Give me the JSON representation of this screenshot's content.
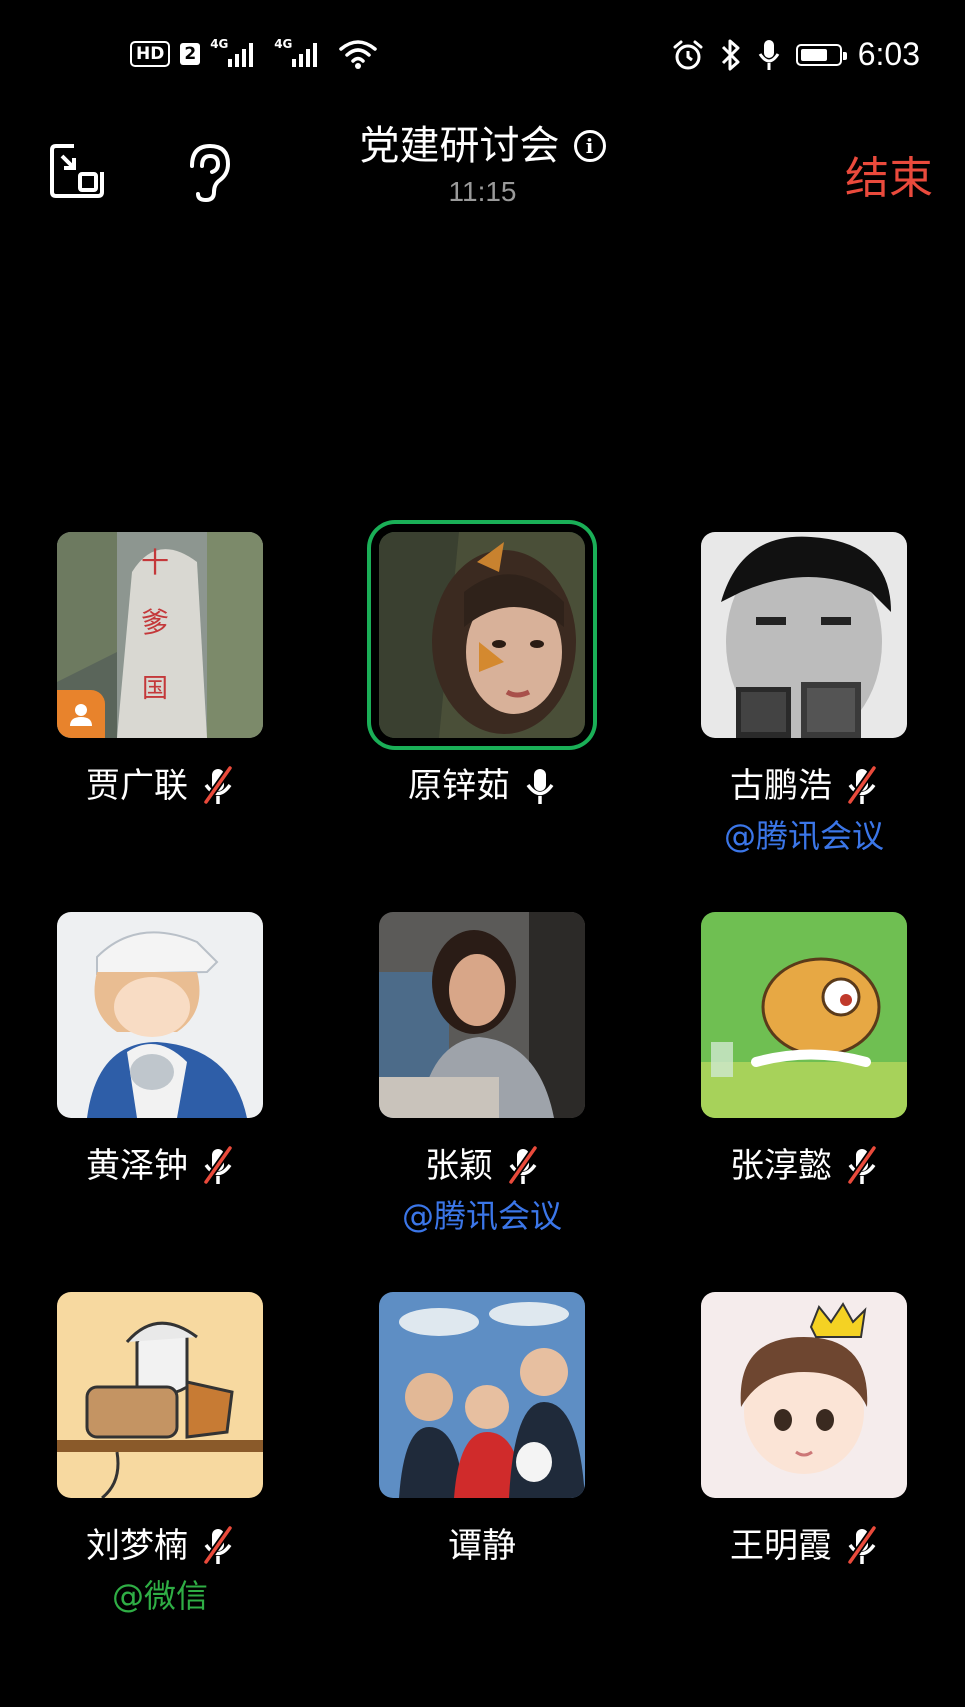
{
  "status_bar": {
    "hd_label": "HD",
    "sim_label": "2",
    "network_1": "4G",
    "network_2": "4G",
    "time": "6:03",
    "battery_level": 0.62,
    "icons": [
      "alarm-icon",
      "bluetooth-icon",
      "microphone-icon",
      "battery-icon",
      "wifi-icon"
    ]
  },
  "header": {
    "title": "党建研讨会",
    "duration": "11:15",
    "end_label": "结束",
    "end_color": "#ea4a3c",
    "icons": [
      "minimize-window-icon",
      "earpiece-icon",
      "info-icon"
    ]
  },
  "participants": [
    {
      "name": "贾广联",
      "mic": "muted",
      "tag": "",
      "host": true,
      "speaking": false
    },
    {
      "name": "原锌茹",
      "mic": "on",
      "tag": "",
      "host": false,
      "speaking": true
    },
    {
      "name": "古鹏浩",
      "mic": "muted",
      "tag": "@腾讯会议",
      "host": false,
      "speaking": false
    },
    {
      "name": "黄泽钟",
      "mic": "muted",
      "tag": "",
      "host": false,
      "speaking": false
    },
    {
      "name": "张颖",
      "mic": "muted",
      "tag": "@腾讯会议",
      "host": false,
      "speaking": false
    },
    {
      "name": "张淳懿",
      "mic": "muted",
      "tag": "",
      "host": false,
      "speaking": false
    },
    {
      "name": "刘梦楠",
      "mic": "muted",
      "tag": "@微信",
      "host": false,
      "speaking": false
    },
    {
      "name": "谭静",
      "mic": "none",
      "tag": "",
      "host": false,
      "speaking": false
    },
    {
      "name": "王明霞",
      "mic": "muted",
      "tag": "",
      "host": false,
      "speaking": false
    }
  ],
  "colors": {
    "speaking_border": "#1aaf57",
    "tag_tencent": "#3b76e8",
    "tag_wechat": "#2fae45",
    "host_badge": "#e8832c"
  }
}
